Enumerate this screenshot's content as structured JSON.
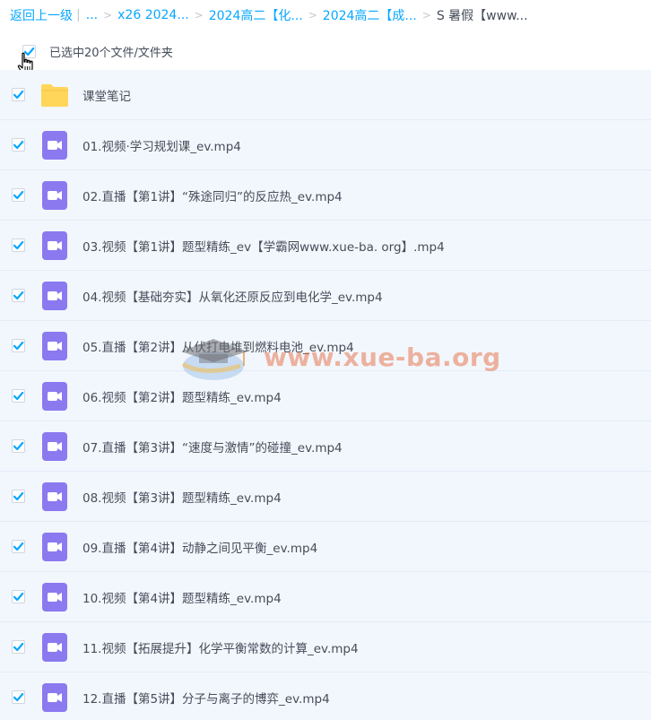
{
  "breadcrumb": {
    "back": "返回上一级",
    "ellipsis": "...",
    "items": [
      "x26 2024...",
      "2024高二【化...",
      "2024高二【成..."
    ],
    "current": "S 暑假【www..."
  },
  "selection": {
    "text": "已选中20个文件/文件夹",
    "checked": true
  },
  "files": [
    {
      "name": "课堂笔记",
      "type": "folder"
    },
    {
      "name": "01.视频·学习规划课_ev.mp4",
      "type": "video"
    },
    {
      "name": "02.直播【第1讲】“殊途同归”的反应热_ev.mp4",
      "type": "video"
    },
    {
      "name": "03.视频【第1讲】题型精练_ev【学霸网www.xue-ba. org】.mp4",
      "type": "video"
    },
    {
      "name": "04.视频【基础夯实】从氧化还原反应到电化学_ev.mp4",
      "type": "video"
    },
    {
      "name": "05.直播【第2讲】从伏打电堆到燃料电池_ev.mp4",
      "type": "video"
    },
    {
      "name": "06.视频【第2讲】题型精练_ev.mp4",
      "type": "video"
    },
    {
      "name": "07.直播【第3讲】“速度与激情”的碰撞_ev.mp4",
      "type": "video"
    },
    {
      "name": "08.视频【第3讲】题型精练_ev.mp4",
      "type": "video"
    },
    {
      "name": "09.直播【第4讲】动静之间见平衡_ev.mp4",
      "type": "video"
    },
    {
      "name": "10.视频【第4讲】题型精练_ev.mp4",
      "type": "video"
    },
    {
      "name": "11.视频【拓展提升】化学平衡常数的计算_ev.mp4",
      "type": "video"
    },
    {
      "name": "12.直播【第5讲】分子与离子的博弈_ev.mp4",
      "type": "video"
    }
  ],
  "watermark": {
    "text": "www.xue-ba.org"
  },
  "colors": {
    "link": "#06a7ff",
    "check": "#06a7ff",
    "row_bg": "#f2f7fd",
    "video_icon": "#8b79f0",
    "folder_icon": "#ffd65a"
  }
}
